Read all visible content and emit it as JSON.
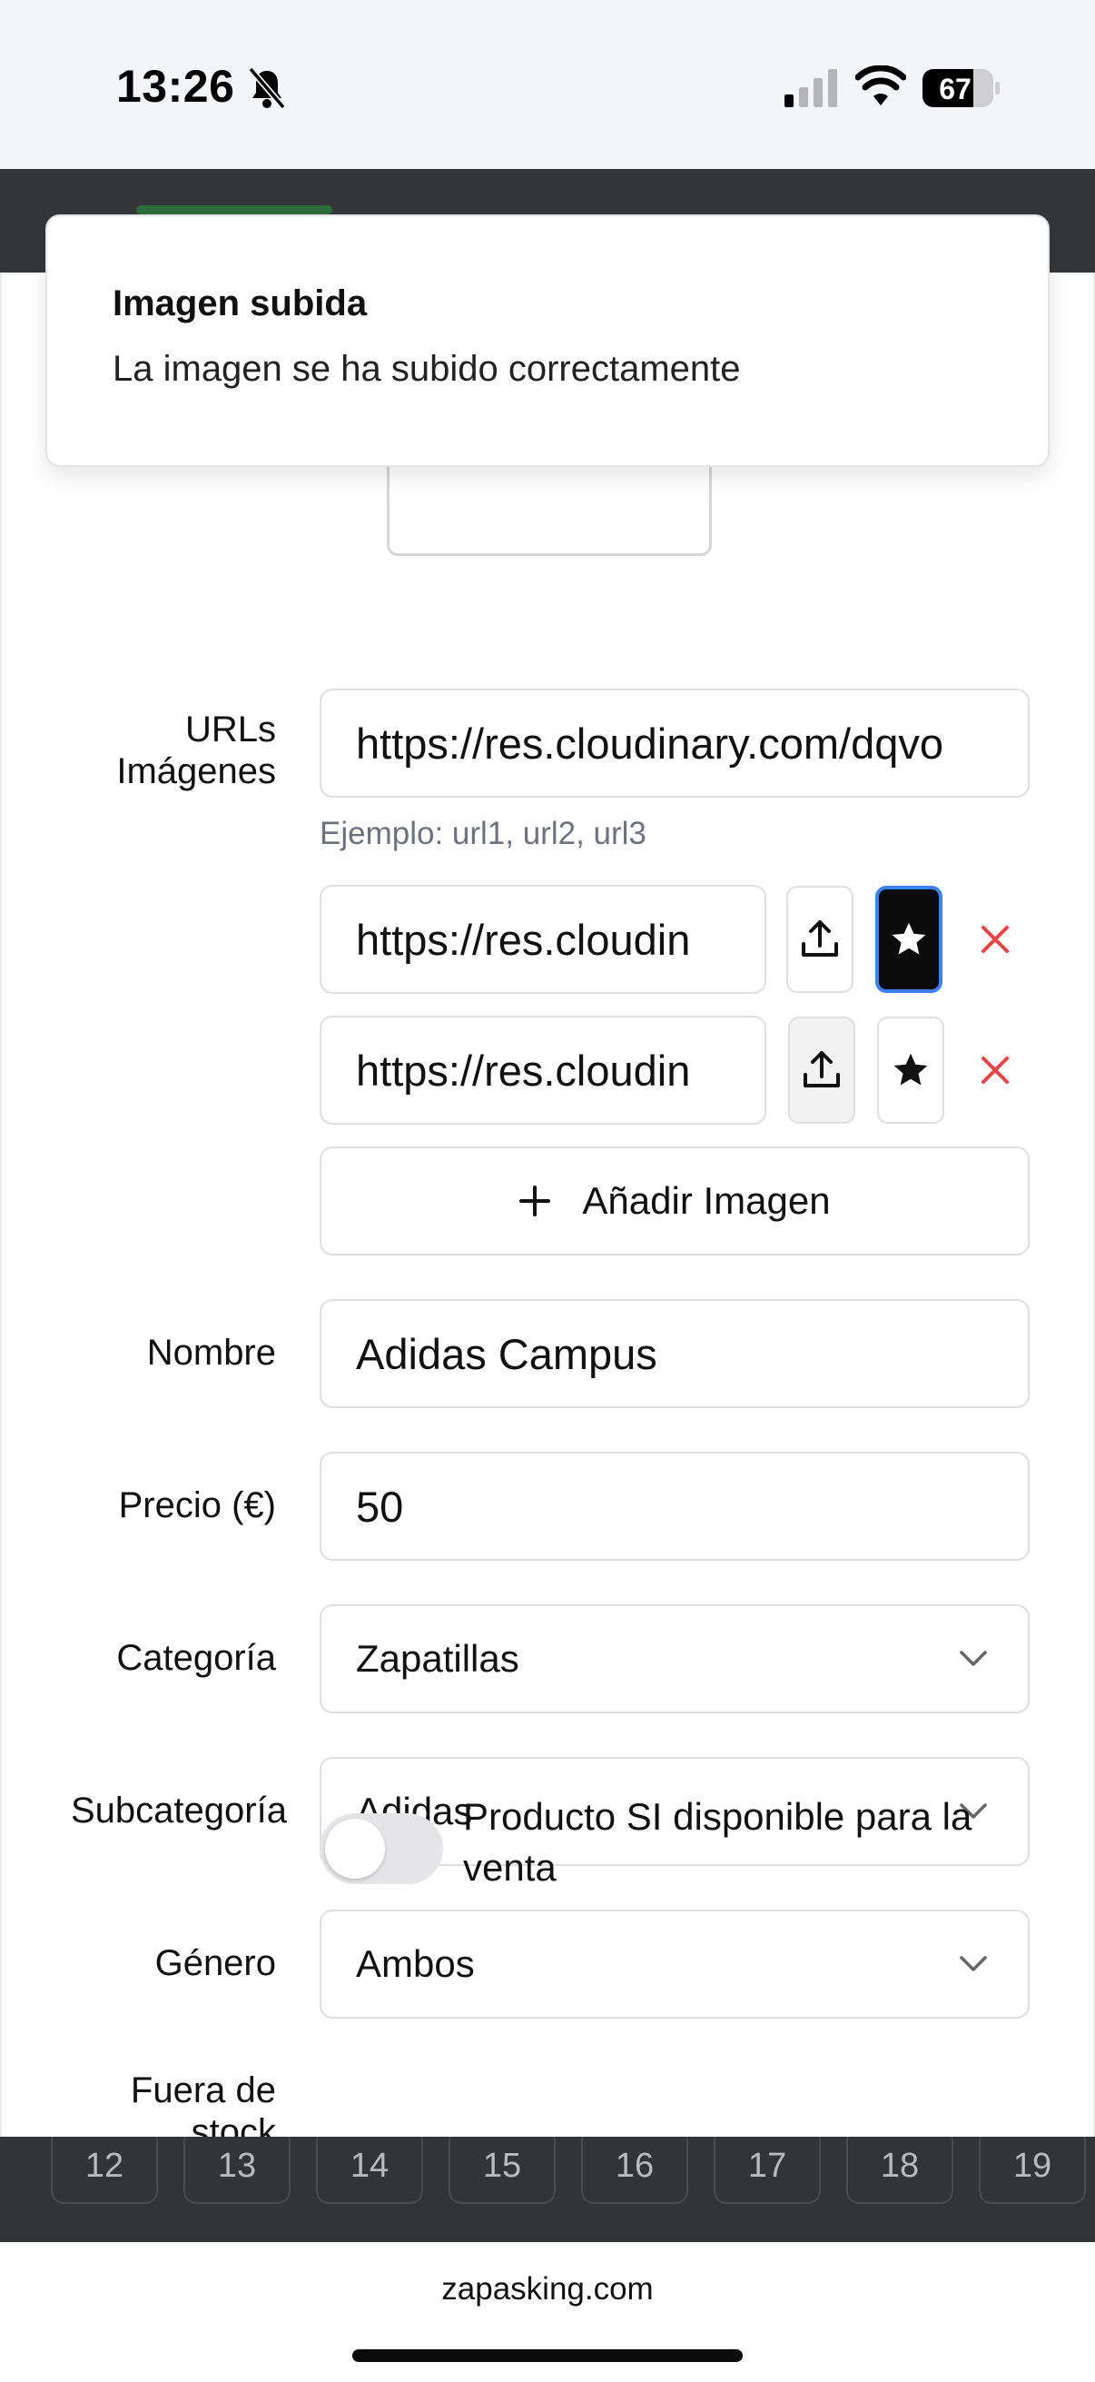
{
  "status_bar": {
    "time": "13:26",
    "battery": "67",
    "icons": [
      "bell-slash-icon",
      "signal-icon",
      "wifi-icon",
      "battery-icon"
    ]
  },
  "toast": {
    "title": "Imagen subida",
    "message": "La imagen se ha subido correctamente"
  },
  "form": {
    "urls_label": "URLs Imágenes",
    "urls_value": "https://res.cloudinary.com/dqvo",
    "urls_hint": "Ejemplo: url1, url2, url3",
    "image_rows": [
      {
        "url": "https://res.cloudin",
        "favorite": true
      },
      {
        "url": "https://res.cloudin",
        "favorite": false
      }
    ],
    "add_image_label": "Añadir Imagen",
    "name_label": "Nombre",
    "name_value": "Adidas Campus",
    "price_label": "Precio (€)",
    "price_value": "50",
    "category_label": "Categoría",
    "category_value": "Zapatillas",
    "subcategory_label": "Subcategoría",
    "subcategory_value": "Adidas",
    "gender_label": "Género",
    "gender_value": "Ambos",
    "out_of_stock_label": "Fuera de stock",
    "out_of_stock_text": "Producto SI disponible para la venta",
    "out_of_stock_on": false
  },
  "calendar_days": [
    "12",
    "13",
    "14",
    "15",
    "16",
    "17",
    "18",
    "19"
  ],
  "browser": {
    "url": "zapasking.com"
  },
  "colors": {
    "accent_blue": "#3b82f6",
    "danger_red": "#ef4444",
    "dark_bg": "#353637"
  }
}
